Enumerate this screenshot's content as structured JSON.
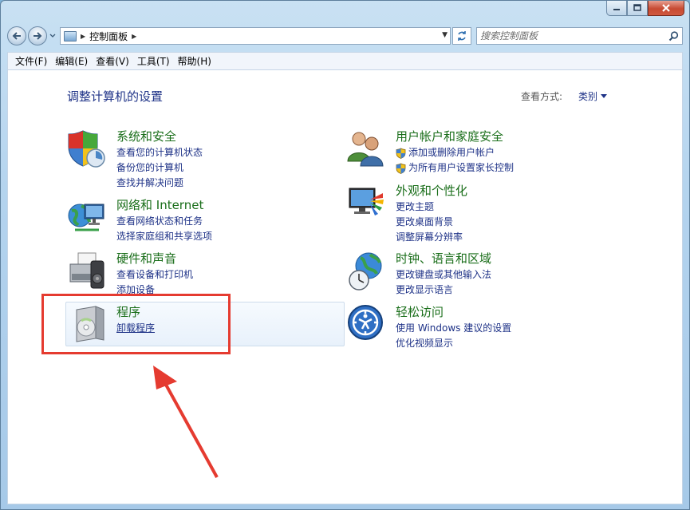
{
  "window": {
    "breadcrumb": [
      "控制面板"
    ],
    "search": {
      "placeholder": "搜索控制面板"
    }
  },
  "menu": [
    "文件(F)",
    "编辑(E)",
    "查看(V)",
    "工具(T)",
    "帮助(H)"
  ],
  "content": {
    "title": "调整计算机的设置",
    "view_by_label": "查看方式:",
    "view_by_value": "类别"
  },
  "categories": [
    {
      "title": "系统和安全",
      "icon": "shield-icon",
      "links": [
        "查看您的计算机状态",
        "备份您的计算机",
        "查找并解决问题"
      ]
    },
    {
      "title": "网络和 Internet",
      "icon": "network-icon",
      "links": [
        "查看网络状态和任务",
        "选择家庭组和共享选项"
      ]
    },
    {
      "title": "硬件和声音",
      "icon": "printer-icon",
      "links": [
        "查看设备和打印机",
        "添加设备"
      ]
    },
    {
      "title": "程序",
      "icon": "programs-icon",
      "links": [
        "卸载程序"
      ]
    },
    {
      "title": "用户帐户和家庭安全",
      "icon": "users-icon",
      "links": [
        "添加或删除用户帐户",
        "为所有用户设置家长控制"
      ]
    },
    {
      "title": "外观和个性化",
      "icon": "monitor-icon",
      "links": [
        "更改主题",
        "更改桌面背景",
        "调整屏幕分辨率"
      ]
    },
    {
      "title": "时钟、语言和区域",
      "icon": "globe-clock-icon",
      "links": [
        "更改键盘或其他输入法",
        "更改显示语言"
      ]
    },
    {
      "title": "轻松访问",
      "icon": "ease-of-access-icon",
      "links": [
        "使用 Windows 建议的设置",
        "优化视频显示"
      ]
    }
  ],
  "colors": {
    "annotation": "#e53b30",
    "link": "#1e3287",
    "category_title": "#1a6e1a"
  }
}
